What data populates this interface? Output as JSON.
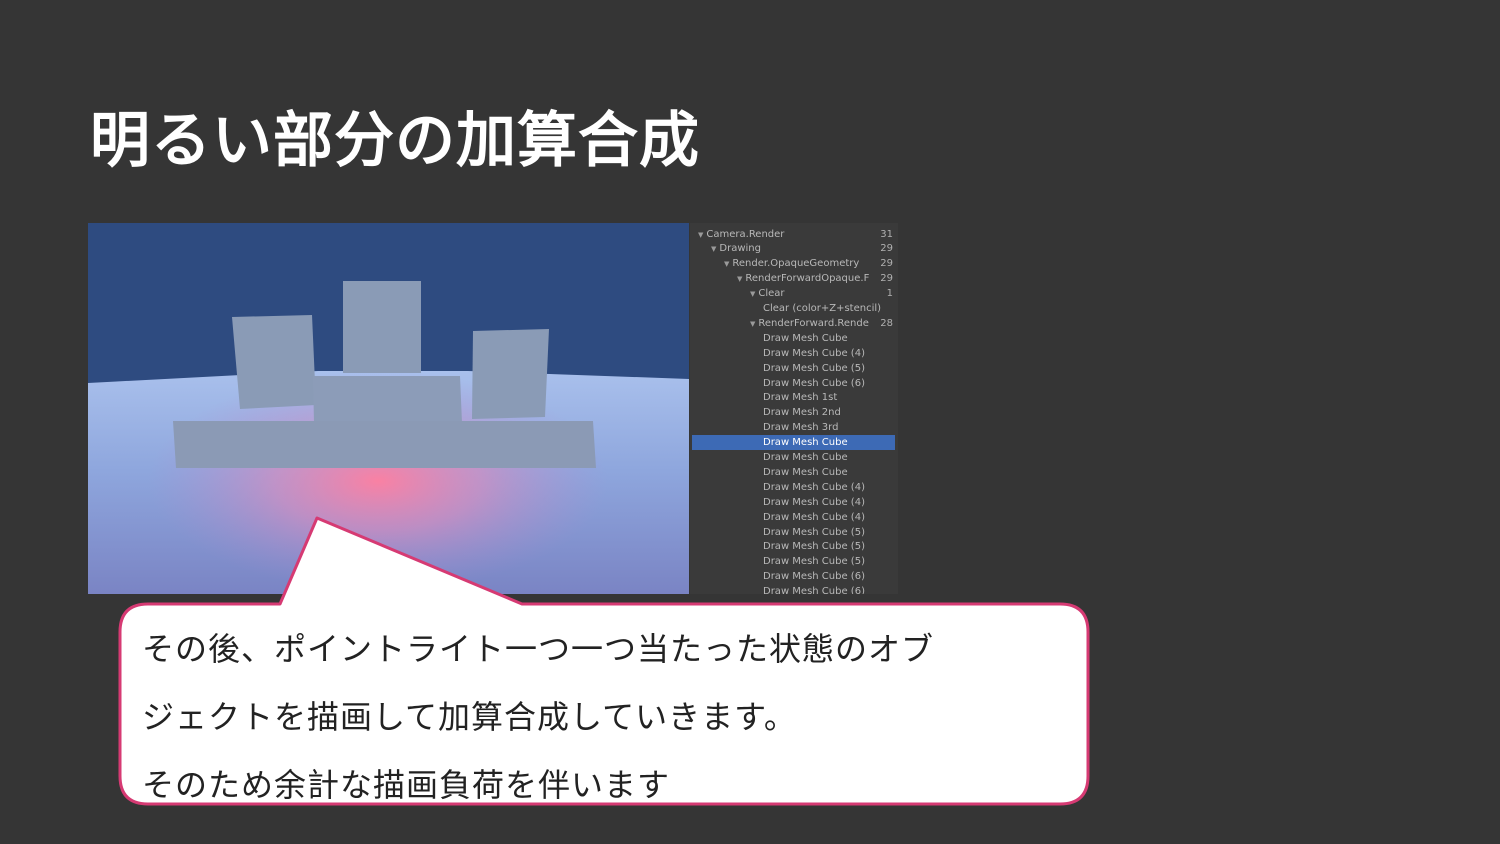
{
  "title": "明るい部分の加算合成",
  "frame_debugger": {
    "rows": [
      {
        "label": "Camera.Render",
        "count": "31",
        "indent": 0,
        "expanded": true
      },
      {
        "label": "Drawing",
        "count": "29",
        "indent": 1,
        "expanded": true
      },
      {
        "label": "Render.OpaqueGeometry",
        "count": "29",
        "indent": 2,
        "expanded": true
      },
      {
        "label": "RenderForwardOpaque.F",
        "count": "29",
        "indent": 3,
        "expanded": true
      },
      {
        "label": "Clear",
        "count": "1",
        "indent": 4,
        "expanded": true
      },
      {
        "label": "Clear (color+Z+stencil)",
        "count": "",
        "indent": 5,
        "expanded": false
      },
      {
        "label": "RenderForward.Rende",
        "count": "28",
        "indent": 4,
        "expanded": true
      },
      {
        "label": "Draw Mesh Cube",
        "count": "",
        "indent": 5,
        "expanded": false
      },
      {
        "label": "Draw Mesh Cube (4)",
        "count": "",
        "indent": 5,
        "expanded": false
      },
      {
        "label": "Draw Mesh Cube (5)",
        "count": "",
        "indent": 5,
        "expanded": false
      },
      {
        "label": "Draw Mesh Cube (6)",
        "count": "",
        "indent": 5,
        "expanded": false
      },
      {
        "label": "Draw Mesh 1st",
        "count": "",
        "indent": 5,
        "expanded": false
      },
      {
        "label": "Draw Mesh 2nd",
        "count": "",
        "indent": 5,
        "expanded": false
      },
      {
        "label": "Draw Mesh 3rd",
        "count": "",
        "indent": 5,
        "expanded": false
      },
      {
        "label": "Draw Mesh Cube",
        "count": "",
        "indent": 5,
        "expanded": false,
        "selected": true
      },
      {
        "label": "Draw Mesh Cube",
        "count": "",
        "indent": 5,
        "expanded": false
      },
      {
        "label": "Draw Mesh Cube",
        "count": "",
        "indent": 5,
        "expanded": false
      },
      {
        "label": "Draw Mesh Cube (4)",
        "count": "",
        "indent": 5,
        "expanded": false
      },
      {
        "label": "Draw Mesh Cube (4)",
        "count": "",
        "indent": 5,
        "expanded": false
      },
      {
        "label": "Draw Mesh Cube (4)",
        "count": "",
        "indent": 5,
        "expanded": false
      },
      {
        "label": "Draw Mesh Cube (5)",
        "count": "",
        "indent": 5,
        "expanded": false
      },
      {
        "label": "Draw Mesh Cube (5)",
        "count": "",
        "indent": 5,
        "expanded": false
      },
      {
        "label": "Draw Mesh Cube (5)",
        "count": "",
        "indent": 5,
        "expanded": false
      },
      {
        "label": "Draw Mesh Cube (6)",
        "count": "",
        "indent": 5,
        "expanded": false
      },
      {
        "label": "Draw Mesh Cube (6)",
        "count": "",
        "indent": 5,
        "expanded": false
      }
    ],
    "expand_glyph": "▼"
  },
  "callout": {
    "lines": [
      "その後、ポイントライト一つ一つ当たった状態のオブ",
      "ジェクトを描画して加算合成していきます。",
      "そのため余計な描画負荷を伴います"
    ],
    "border_color": "#d63a73"
  },
  "colors": {
    "background": "#353535",
    "sky": "#2e4b80",
    "selection": "#3d6ab5",
    "light_glow": "#ff7fa0"
  }
}
